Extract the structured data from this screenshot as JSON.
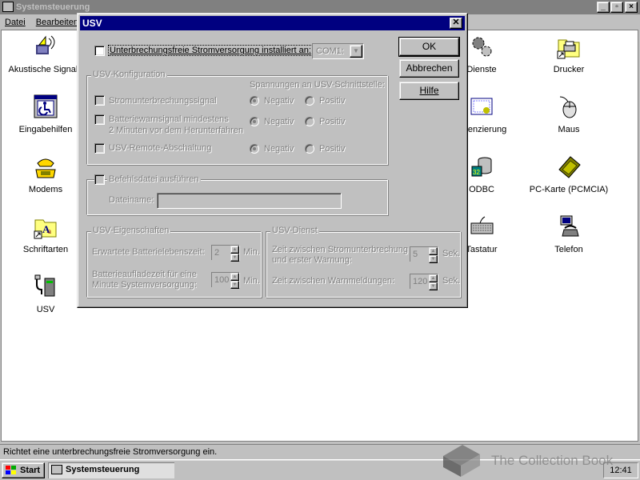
{
  "main_window": {
    "title": "Systemsteuerung",
    "menu": [
      "Datei",
      "Bearbeiten"
    ],
    "status_text": "Richtet eine unterbrechungsfreie Stromversorgung ein."
  },
  "icons": [
    {
      "label": "Akustische Signale",
      "icon": "speaker-icon"
    },
    {
      "label": "Eingabehilfen",
      "icon": "accessibility-icon"
    },
    {
      "label": "Modems",
      "icon": "modem-icon"
    },
    {
      "label": "Schriftarten",
      "icon": "fonts-folder-icon"
    },
    {
      "label": "USV",
      "icon": "ups-icon"
    },
    {
      "label": "Dienste",
      "icon": "services-gears-icon"
    },
    {
      "label": "Lizenzierung",
      "icon": "license-certificate-icon"
    },
    {
      "label": "ODBC",
      "icon": "odbc-database-icon"
    },
    {
      "label": "Tastatur",
      "icon": "keyboard-icon"
    },
    {
      "label": "Drucker",
      "icon": "printers-folder-icon"
    },
    {
      "label": "Maus",
      "icon": "mouse-icon"
    },
    {
      "label": "PC-Karte (PCMCIA)",
      "icon": "pc-card-icon"
    },
    {
      "label": "Telefon",
      "icon": "telephony-icon"
    }
  ],
  "dialog": {
    "title": "USV",
    "installed_label": "Unterbrechungsfreie Stromversorgung installiert an:",
    "installed_checked": false,
    "port_value": "COM1:",
    "buttons": {
      "ok": "OK",
      "cancel": "Abbrechen",
      "help": "Hilfe"
    },
    "config": {
      "group_label": "USV-Konfiguration",
      "voltage_header": "Spannungen an USV-Schnittstelle:",
      "rows": [
        {
          "label": "Stromunterbrechungssignal",
          "neg": "Negativ",
          "pos": "Positiv",
          "selected": "Negativ"
        },
        {
          "label": "Batteriewarnsignal mindestens",
          "label2": "2 Minuten vor dem Herunterfahren",
          "neg": "Negativ",
          "pos": "Positiv",
          "selected": "Negativ"
        },
        {
          "label": "USV-Remote-Abschaltung",
          "neg": "Negativ",
          "pos": "Positiv",
          "selected": "Negativ"
        }
      ]
    },
    "command": {
      "checkbox_label": "Befehlsdatei ausführen",
      "file_label": "Dateiname:",
      "file_value": ""
    },
    "properties": {
      "group_label": "USV-Eigenschaften",
      "battery_life_label": "Erwartete Batterielebenszeit:",
      "battery_life_value": "2",
      "battery_life_unit": "Min.",
      "recharge_label_1": "Batterieaufladezeit für eine",
      "recharge_label_2": "Minute Systemversorgung:",
      "recharge_value": "100",
      "recharge_unit": "Min."
    },
    "service": {
      "group_label": "USV-Dienst",
      "first_warning_label_1": "Zeit zwischen Stromunterbrechung",
      "first_warning_label_2": "und erster Warnung:",
      "first_warning_value": "5",
      "first_warning_unit": "Sek.",
      "interval_label": "Zeit zwischen Warnmeldungen:",
      "interval_value": "120",
      "interval_unit": "Sek."
    }
  },
  "taskbar": {
    "start_label": "Start",
    "task_label": "Systemsteuerung",
    "clock": "12:41"
  },
  "watermark": "The Collection Book"
}
